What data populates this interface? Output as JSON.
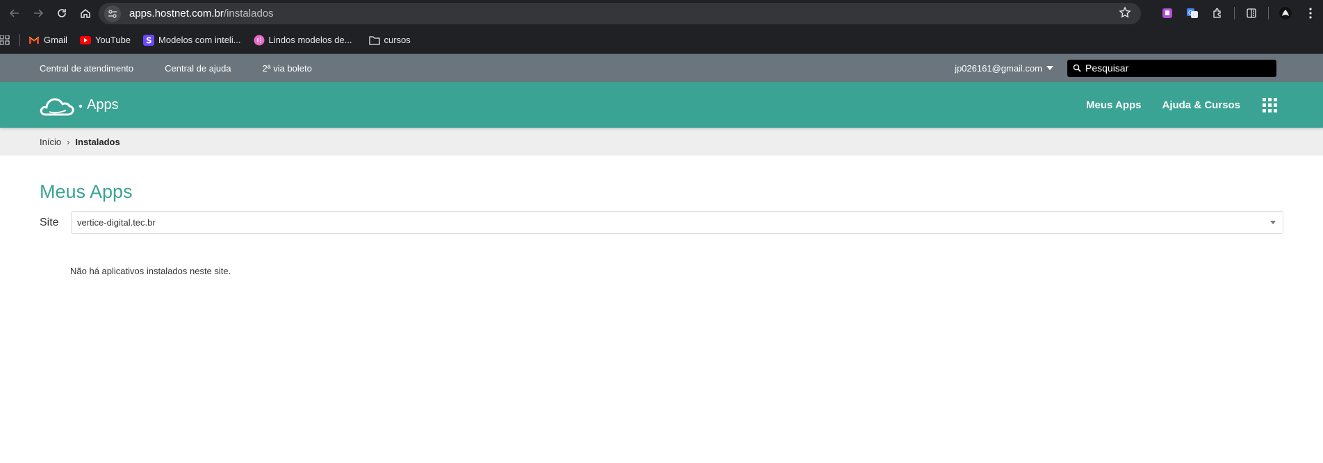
{
  "browser": {
    "url_host": "apps.hostnet.com.br",
    "url_path": "/instalados",
    "bookmarks": [
      {
        "label": "Gmail",
        "icon": "gmail-icon"
      },
      {
        "label": "YouTube",
        "icon": "youtube-icon"
      },
      {
        "label": "Modelos com inteli...",
        "icon": "s-app-icon"
      },
      {
        "label": "Lindos modelos de...",
        "icon": "pink-circle-icon"
      },
      {
        "label": "cursos",
        "icon": "folder-icon"
      }
    ]
  },
  "topbar": {
    "links": [
      "Central de atendimento",
      "Central de ajuda",
      "2ª via boleto"
    ],
    "account_email": "jp026161@gmail.com",
    "search_placeholder": "Pesquisar"
  },
  "header": {
    "logo_text": "Apps",
    "nav": [
      "Meus Apps",
      "Ajuda & Cursos"
    ]
  },
  "breadcrumb": {
    "home": "Início",
    "current": "Instalados"
  },
  "main": {
    "title": "Meus Apps",
    "site_label": "Site",
    "site_selected": "vertice-digital.tec.br",
    "empty_message": "Não há aplicativos instalados neste site."
  },
  "colors": {
    "brand_green": "#3aa393",
    "topbar_gray": "#6b757d",
    "chrome_dark": "#202124"
  }
}
